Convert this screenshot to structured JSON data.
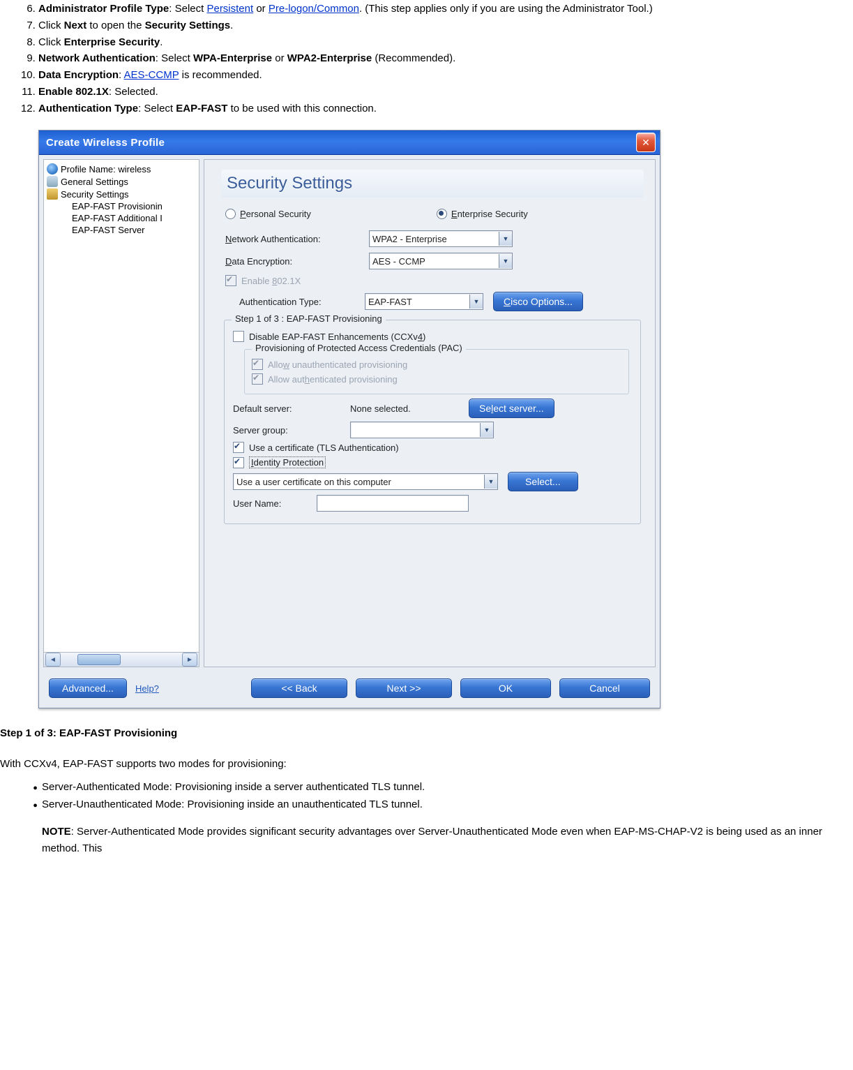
{
  "list": {
    "i6_b": "Administrator Profile Type",
    "i6_a": ": Select ",
    "i6_l1": "Persistent",
    "i6_mid": " or ",
    "i6_l2": "Pre-logon/Common",
    "i6_c": ". (This step applies only if you are using the Administrator Tool.)",
    "i7_a": "Click ",
    "i7_b1": "Next",
    "i7_mid": " to open the ",
    "i7_b2": "Security Settings",
    "i7_c": ".",
    "i8_a": "Click ",
    "i8_b1": "Enterprise Security",
    "i8_c": ".",
    "i9_b": "Network Authentication",
    "i9_a": ": Select ",
    "i9_b2": "WPA-Enterprise",
    "i9_mid": " or ",
    "i9_b3": "WPA2-Enterprise",
    "i9_c": " (Recommended).",
    "i10_b": "Data Encryption",
    "i10_a": ": ",
    "i10_l": "AES-CCMP",
    "i10_c": " is recommended.",
    "i11_b": "Enable 802.1X",
    "i11_c": ": Selected.",
    "i12_b": "Authentication Type",
    "i12_a": ": Select ",
    "i12_b2": "EAP-FAST",
    "i12_c": " to be used with this connection."
  },
  "dialog": {
    "title": "Create Wireless Profile",
    "tree": {
      "profile": "Profile Name: wireless",
      "general": "General Settings",
      "security": "Security Settings",
      "sub1": "EAP-FAST Provisionin",
      "sub2": "EAP-FAST Additional I",
      "sub3": "EAP-FAST Server"
    },
    "heading": "Security Settings",
    "radio_personal": "Personal Security",
    "radio_enterprise": "Enterprise Security",
    "netauth_label": "Network Authentication:",
    "netauth_value": "WPA2 - Enterprise",
    "dataenc_label": "Data Encryption:",
    "dataenc_value": "AES - CCMP",
    "enable8021x": "Enable 802.1X",
    "authtype_label": "Authentication Type:",
    "authtype_value": "EAP-FAST",
    "cisco_btn": "Cisco Options...",
    "step_legend": "Step 1 of 3 : EAP-FAST Provisioning",
    "disable_enh": "Disable EAP-FAST Enhancements (CCXv4)",
    "pac_legend": "Provisioning of Protected Access Credentials (PAC)",
    "allow_unauth": "Allow unauthenticated provisioning",
    "allow_auth": "Allow authenticated provisioning",
    "def_server_label": "Default server:",
    "def_server_val": "None selected.",
    "select_server_btn": "Select server...",
    "server_group_label": "Server group:",
    "use_cert": "Use a certificate (TLS Authentication)",
    "id_protect": "Identity Protection",
    "cert_select_val": "Use a user certificate on this computer",
    "select_btn": "Select...",
    "username_label": "User Name:",
    "advanced_btn": "Advanced...",
    "help_link": "Help?",
    "back_btn": "<< Back",
    "next_btn": "Next >>",
    "ok_btn": "OK",
    "cancel_btn": "Cancel"
  },
  "below": {
    "h": "Step 1 of 3: EAP-FAST Provisioning",
    "p1": "With CCXv4, EAP-FAST supports two modes for provisioning:",
    "b1": "Server-Authenticated Mode: Provisioning inside a server authenticated TLS tunnel.",
    "b2": "Server-Unauthenticated Mode: Provisioning inside an unauthenticated TLS tunnel.",
    "note_b": "NOTE",
    "note": ": Server-Authenticated Mode provides significant security advantages over Server-Unauthenticated Mode even when EAP-MS-CHAP-V2 is being used as an inner method. This"
  }
}
